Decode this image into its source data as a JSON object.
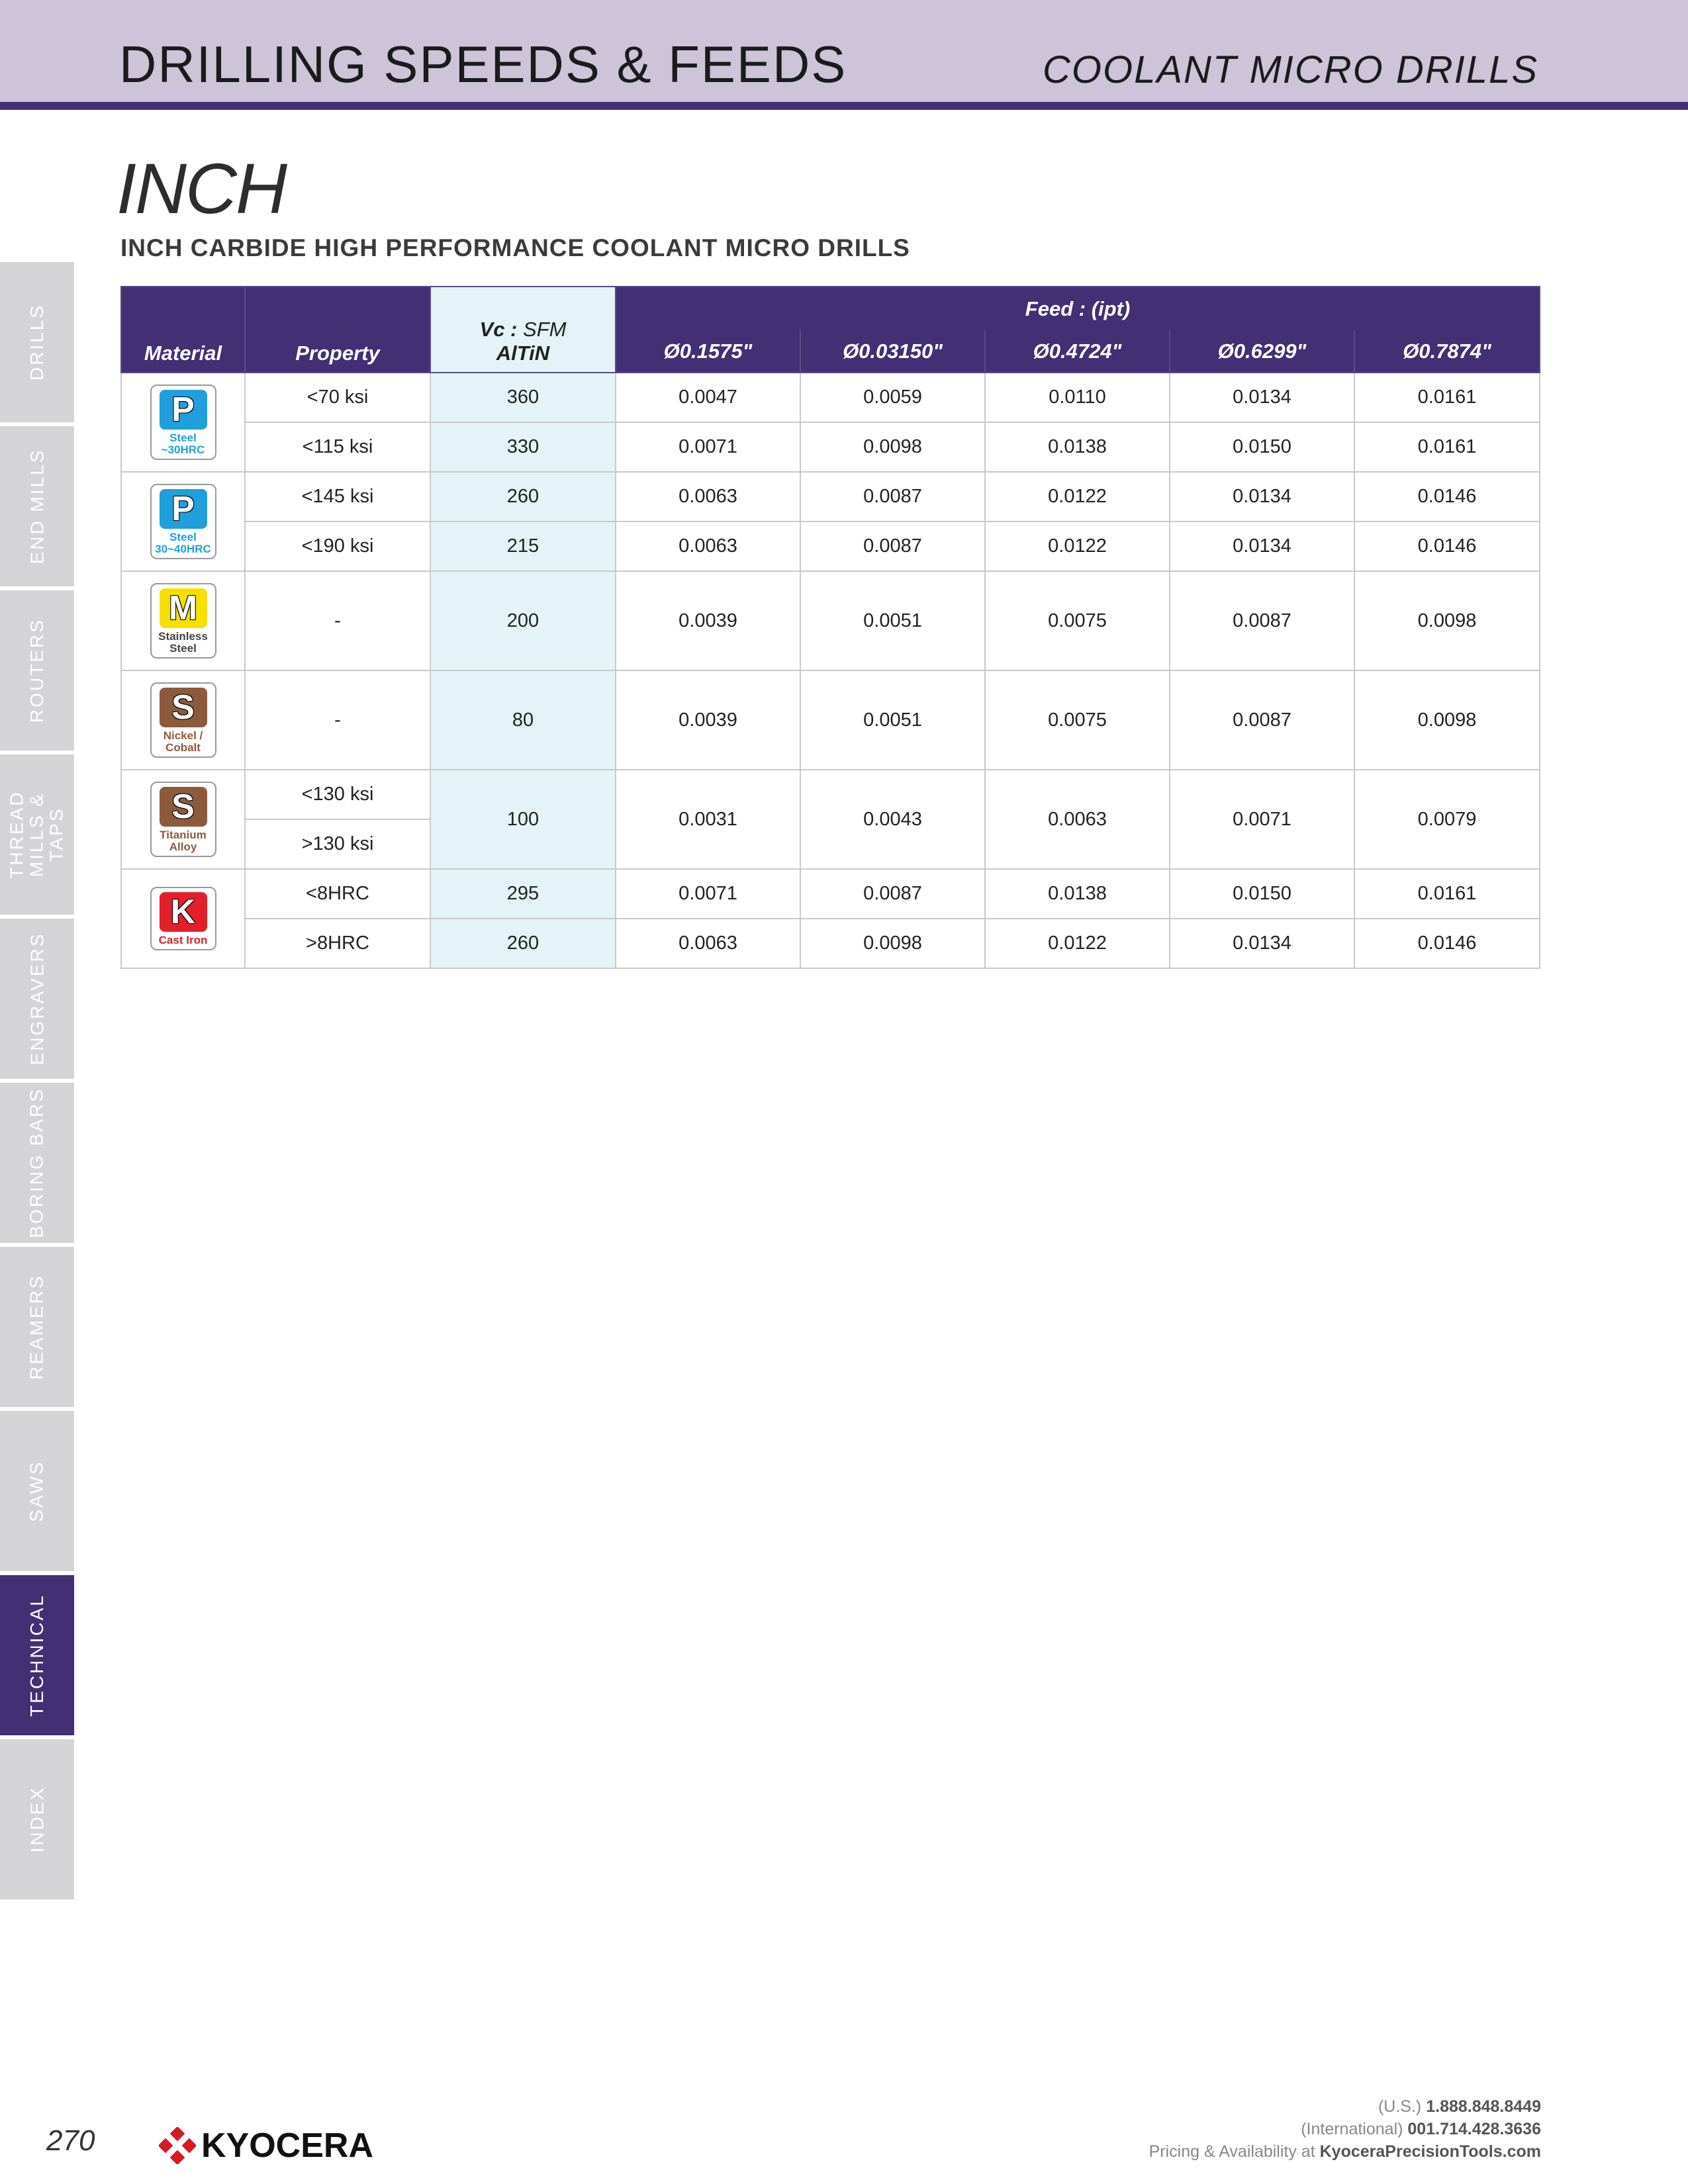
{
  "header": {
    "title": "DRILLING SPEEDS & FEEDS",
    "subtitle": "COOLANT MICRO DRILLS"
  },
  "units_title": "INCH",
  "section_title": "INCH CARBIDE HIGH PERFORMANCE COOLANT MICRO DRILLS",
  "side_tabs": [
    {
      "label": "DRILLS",
      "active": false
    },
    {
      "label": "END MILLS",
      "active": false
    },
    {
      "label": "ROUTERS",
      "active": false
    },
    {
      "label": "THREAD MILLS & TAPS",
      "active": false
    },
    {
      "label": "ENGRAVERS",
      "active": false
    },
    {
      "label": "BORING BARS",
      "active": false
    },
    {
      "label": "REAMERS",
      "active": false
    },
    {
      "label": "SAWS",
      "active": false
    },
    {
      "label": "TECHNICAL",
      "active": true
    },
    {
      "label": "INDEX",
      "active": false
    }
  ],
  "table": {
    "headers": {
      "material": "Material",
      "property": "Property",
      "vc_label": "Vc :",
      "vc_unit": "SFM",
      "coating": "AlTiN",
      "feed": "Feed : (ipt)",
      "diameters": [
        "Ø0.1575\"",
        "Ø0.03150\"",
        "Ø0.4724\"",
        "Ø0.6299\"",
        "Ø0.7874\""
      ]
    },
    "materials": {
      "steel_30": {
        "letter": "P",
        "caption": "Steel ~30HRC"
      },
      "steel_3040": {
        "letter": "P",
        "caption": "Steel 30~40HRC"
      },
      "stainless": {
        "letter": "M",
        "caption": "Stainless Steel"
      },
      "nickel": {
        "letter": "S",
        "caption": "Nickel / Cobalt"
      },
      "titanium": {
        "letter": "S",
        "caption": "Titanium Alloy"
      },
      "cast_iron": {
        "letter": "K",
        "caption": "Cast Iron"
      }
    },
    "rows": [
      {
        "property": "<70 ksi",
        "vc": "360",
        "feeds": [
          "0.0047",
          "0.0059",
          "0.0110",
          "0.0134",
          "0.0161"
        ]
      },
      {
        "property": "<115 ksi",
        "vc": "330",
        "feeds": [
          "0.0071",
          "0.0098",
          "0.0138",
          "0.0150",
          "0.0161"
        ]
      },
      {
        "property": "<145 ksi",
        "vc": "260",
        "feeds": [
          "0.0063",
          "0.0087",
          "0.0122",
          "0.0134",
          "0.0146"
        ]
      },
      {
        "property": "<190 ksi",
        "vc": "215",
        "feeds": [
          "0.0063",
          "0.0087",
          "0.0122",
          "0.0134",
          "0.0146"
        ]
      },
      {
        "property": "-",
        "vc": "200",
        "feeds": [
          "0.0039",
          "0.0051",
          "0.0075",
          "0.0087",
          "0.0098"
        ]
      },
      {
        "property": "-",
        "vc": "80",
        "feeds": [
          "0.0039",
          "0.0051",
          "0.0075",
          "0.0087",
          "0.0098"
        ]
      },
      {
        "property": "<130 ksi",
        "property2": ">130 ksi",
        "vc": "100",
        "feeds": [
          "0.0031",
          "0.0043",
          "0.0063",
          "0.0071",
          "0.0079"
        ]
      },
      {
        "property": "<8HRC",
        "vc": "295",
        "feeds": [
          "0.0071",
          "0.0087",
          "0.0138",
          "0.0150",
          "0.0161"
        ]
      },
      {
        "property": ">8HRC",
        "vc": "260",
        "feeds": [
          "0.0063",
          "0.0098",
          "0.0122",
          "0.0134",
          "0.0146"
        ]
      }
    ]
  },
  "footer": {
    "page_number": "270",
    "brand": "KYOCERA",
    "us_label": "(U.S.)",
    "us_phone": "1.888.848.8449",
    "intl_label": "(International)",
    "intl_phone": "001.714.428.3636",
    "pricing_label": "Pricing & Availability at",
    "website": "KyoceraPrecisionTools.com"
  },
  "colors": {
    "brand_purple": "#432f73",
    "header_band": "#cdc4d9",
    "vc_column": "#e3f3f7",
    "steel_blue": "#1fa0dd",
    "stainless_yellow": "#f6e000",
    "superalloy_brown": "#8c5a3c",
    "cast_iron_red": "#e3202a",
    "kyocera_red": "#d71920"
  }
}
